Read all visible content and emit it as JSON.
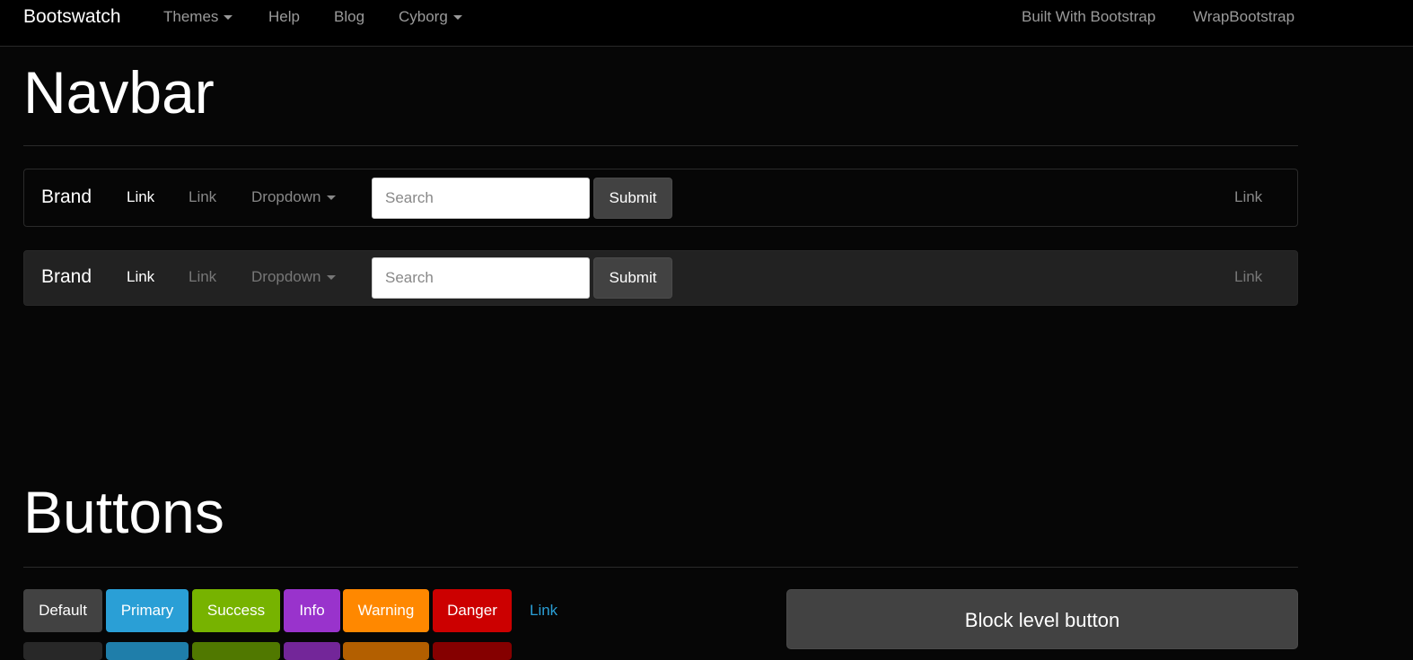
{
  "topnav": {
    "brand": "Bootswatch",
    "items": [
      {
        "label": "Themes",
        "dropdown": true
      },
      {
        "label": "Help",
        "dropdown": false
      },
      {
        "label": "Blog",
        "dropdown": false
      },
      {
        "label": "Cyborg",
        "dropdown": true
      }
    ],
    "right_items": [
      {
        "label": "Built With Bootstrap"
      },
      {
        "label": "WrapBootstrap"
      }
    ]
  },
  "sections": {
    "navbar_heading": "Navbar",
    "buttons_heading": "Buttons"
  },
  "demo_navbars": [
    {
      "brand": "Brand",
      "link_active": "Link",
      "link": "Link",
      "dropdown": "Dropdown",
      "search_placeholder": "Search",
      "submit": "Submit",
      "right_link": "Link"
    },
    {
      "brand": "Brand",
      "link_active": "Link",
      "link": "Link",
      "dropdown": "Dropdown",
      "search_placeholder": "Search",
      "submit": "Submit",
      "right_link": "Link"
    }
  ],
  "buttons": {
    "row1": [
      {
        "label": "Default",
        "color": "#424242"
      },
      {
        "label": "Primary",
        "color": "#2a9fd6"
      },
      {
        "label": "Success",
        "color": "#77b300"
      },
      {
        "label": "Info",
        "color": "#9933cc"
      },
      {
        "label": "Warning",
        "color": "#ff8800"
      },
      {
        "label": "Danger",
        "color": "#cc0000"
      }
    ],
    "link_label": "Link",
    "link_color": "#2a9fd6",
    "row2_colors": [
      "#282828",
      "#1f7eaa",
      "#507800",
      "#732699",
      "#b35f00",
      "#850000"
    ],
    "block_label": "Block level button"
  },
  "colors": {
    "background": "#060606",
    "topnav_bg": "#000000",
    "nav_text": "#9a9a9a",
    "accent": "#2a9fd6"
  }
}
